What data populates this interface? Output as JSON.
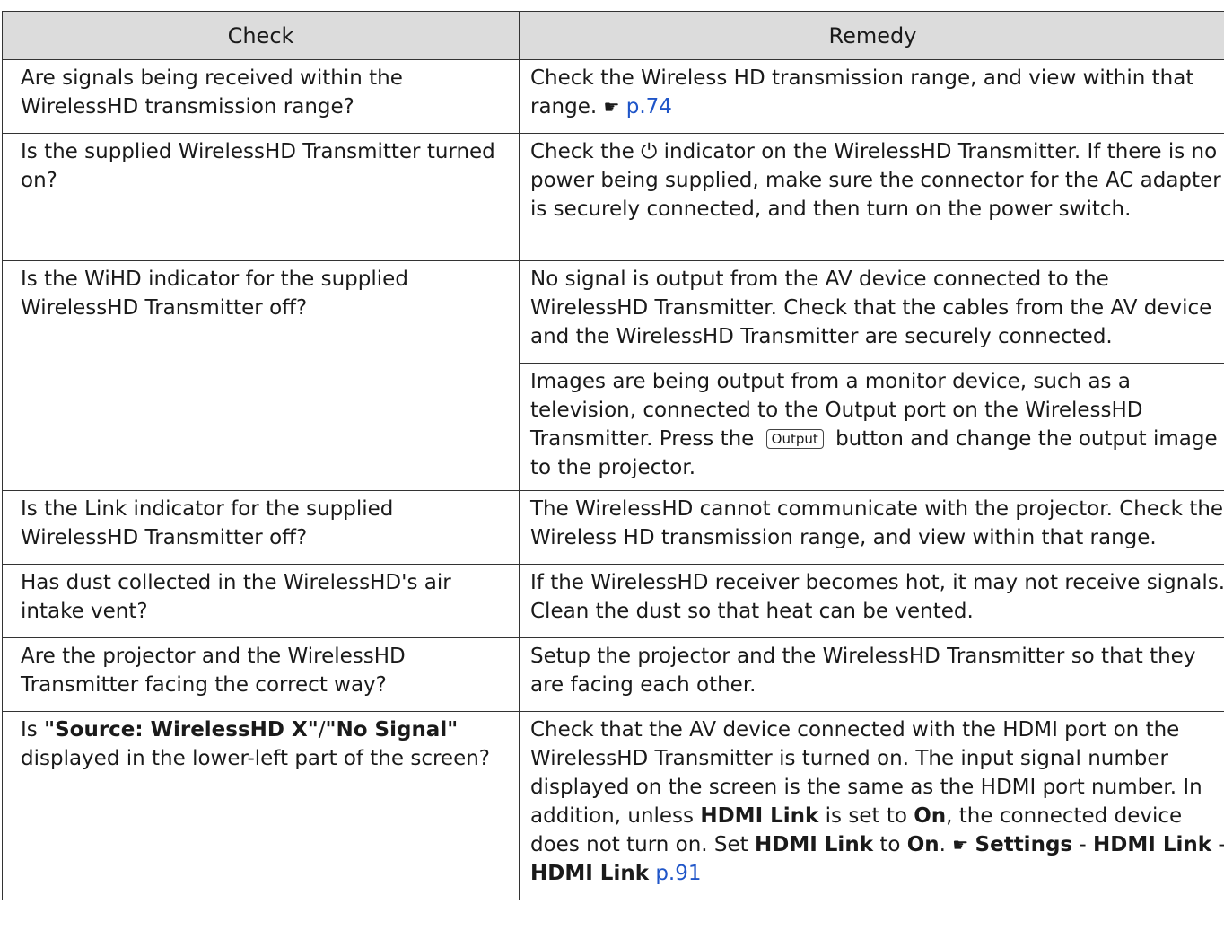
{
  "table": {
    "headers": {
      "check": "Check",
      "remedy": "Remedy"
    },
    "row1": {
      "check": "Are signals being received within the WirelessHD transmission range?",
      "remedy": "Check the Wireless HD transmission range, and view within that range.",
      "ref_icon": "☛",
      "ref_page": "p.74"
    },
    "row2": {
      "check": "Is the supplied WirelessHD Transmitter turned on?",
      "remedy_pre": "Check the",
      "power_symbol": "⏻",
      "remedy_post": "indicator on the WirelessHD Transmitter. If there is no power being supplied, make sure the connector for the AC adapter is securely connected, and then turn on the power switch."
    },
    "row3": {
      "check": "Is the WiHD indicator for the supplied WirelessHD Transmitter off?",
      "remedy_a": "No signal is output from the AV device connected to the WirelessHD Transmitter. Check that the cables from the AV device and the WirelessHD Transmitter are securely connected.",
      "remedy_b_pre": "Images are being output from a monitor device, such as a television, connected to the Output port on the WirelessHD Transmitter. Press the",
      "remedy_b_button": "Output",
      "remedy_b_post": "button and change the output image to the projector."
    },
    "row4": {
      "check": "Is the Link indicator for the supplied WirelessHD Transmitter off?",
      "remedy": "The WirelessHD cannot communicate with the projector. Check the Wireless HD transmission range, and view within that range."
    },
    "row5": {
      "check": "Has dust collected in the WirelessHD's air intake vent?",
      "remedy": "If the WirelessHD receiver becomes hot, it may not receive signals. Clean the dust so that heat can be vented."
    },
    "row6": {
      "check": "Are the projector and the WirelessHD Transmitter facing the correct way?",
      "remedy": "Setup the projector and the WirelessHD Transmitter so that they are facing each other."
    },
    "row7": {
      "check_pre": "Is",
      "check_bold1": "\"Source: WirelessHD X\"",
      "check_slash": "/",
      "check_bold2": "\"No Signal\"",
      "check_post": "displayed in the lower-left part of the screen?",
      "remedy_1": "Check that the AV device connected with the HDMI port on the WirelessHD Transmitter is turned on. The input signal number displayed on the screen is the same as the HDMI port number. In addition, unless",
      "remedy_b1": "HDMI Link",
      "remedy_2": "is set to",
      "remedy_b2": "On",
      "remedy_3": ", the connected device does not turn on. Set",
      "remedy_b3": "HDMI Link",
      "remedy_4": "to",
      "remedy_b4": "On",
      "remedy_5": ".",
      "ref_icon": "☛",
      "nav_settings": "Settings",
      "nav_sep1": "-",
      "nav_hdmi_link_1": "HDMI Link",
      "nav_sep2": "-",
      "nav_hdmi_link_2": "HDMI Link",
      "ref_page": "p.91"
    }
  }
}
